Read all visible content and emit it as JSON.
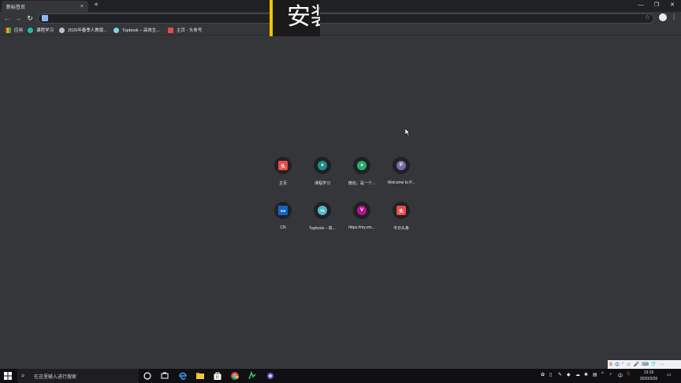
{
  "browser": {
    "tab_title": "新标签页",
    "tab_close": "×",
    "new_tab": "+",
    "window_controls": [
      "—",
      "❐",
      "✕"
    ],
    "nav": {
      "back": "←",
      "forward": "→",
      "reload": "↻"
    },
    "omnibox_value": "",
    "star": "☆",
    "menu": "⋮"
  },
  "bookmarks": [
    {
      "label": "应用",
      "icon": "apps-grid-icon",
      "color": "#ea4335"
    },
    {
      "label": "课程学习",
      "icon": "edge-icon",
      "color": "#29b6a6"
    },
    {
      "label": "2020年春季人教版...",
      "icon": "globe-icon",
      "color": "#bdc1c6"
    },
    {
      "label": "Topbook – 高效生...",
      "icon": "topbook-icon",
      "color": "#7bd4e6"
    },
    {
      "label": "主页 - 头条号",
      "icon": "toutiao-icon",
      "color": "#e64b4b"
    }
  ],
  "overlay": {
    "text": "安装"
  },
  "shortcuts": [
    {
      "label": "主页",
      "icon": "toutiao-icon",
      "fav_color": "#e64b4b",
      "glyph": "头"
    },
    {
      "label": "课程学习",
      "icon": "edge-icon",
      "fav_color": "#1d8f8a",
      "glyph": "e"
    },
    {
      "label": "微信，是一个...",
      "icon": "wechat-icon",
      "fav_color": "#2aae67",
      "glyph": "●"
    },
    {
      "label": "Welcome to P...",
      "icon": "letter-p-icon",
      "fav_color": "#7a6aa0",
      "glyph": "P"
    },
    {
      "label": "CN",
      "icon": "vmware-icon",
      "fav_color": "#1565c0",
      "glyph": "vm"
    },
    {
      "label": "Topbook – 高...",
      "icon": "topbook-icon",
      "fav_color": "#4fb9c9",
      "glyph": "Tb"
    },
    {
      "label": "https://my.vm...",
      "icon": "letter-v-icon",
      "fav_color": "#b5128f",
      "glyph": "V"
    },
    {
      "label": "今日头条",
      "icon": "toutiao-icon",
      "fav_color": "#e64b4b",
      "glyph": "头"
    }
  ],
  "taskbar": {
    "search_placeholder": "在这里输入进行搜索",
    "pinned": [
      "cortana-icon",
      "task-view-icon",
      "edge-icon",
      "file-explorer-icon",
      "store-icon",
      "chrome-icon",
      "maps-icon",
      "app-icon"
    ],
    "time": "13:15",
    "date": "2020/3/26",
    "ime_lang": "中"
  },
  "ime_bar": [
    "S",
    "中",
    "°",
    "☺",
    "🎤",
    "⌨",
    "👕",
    "⋯"
  ]
}
